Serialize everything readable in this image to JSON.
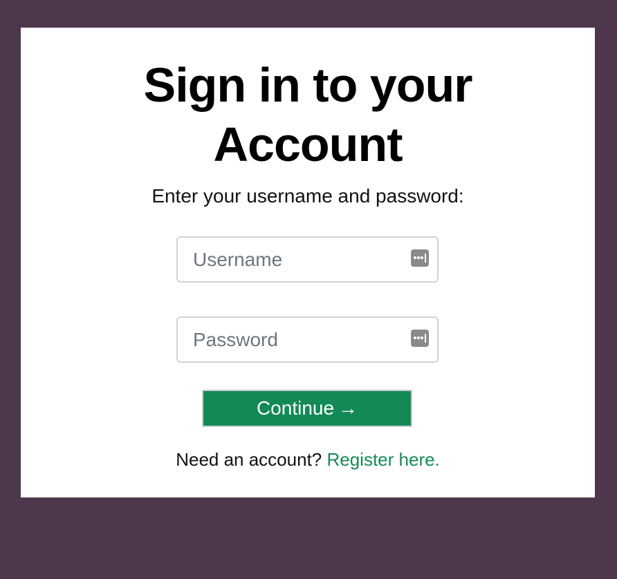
{
  "colors": {
    "background": "#4d374c",
    "card": "#ffffff",
    "accent": "#138a56"
  },
  "login": {
    "title_line1": "Sign in to your",
    "title_line2": "Account",
    "subtitle": "Enter your username and password:",
    "username_placeholder": "Username",
    "password_placeholder": "Password",
    "continue_label": "Continue",
    "continue_arrow": "→",
    "register_prompt": "Need an account?",
    "register_link": "Register here."
  },
  "icons": {
    "field_icon": "password-manager-keys-icon"
  }
}
